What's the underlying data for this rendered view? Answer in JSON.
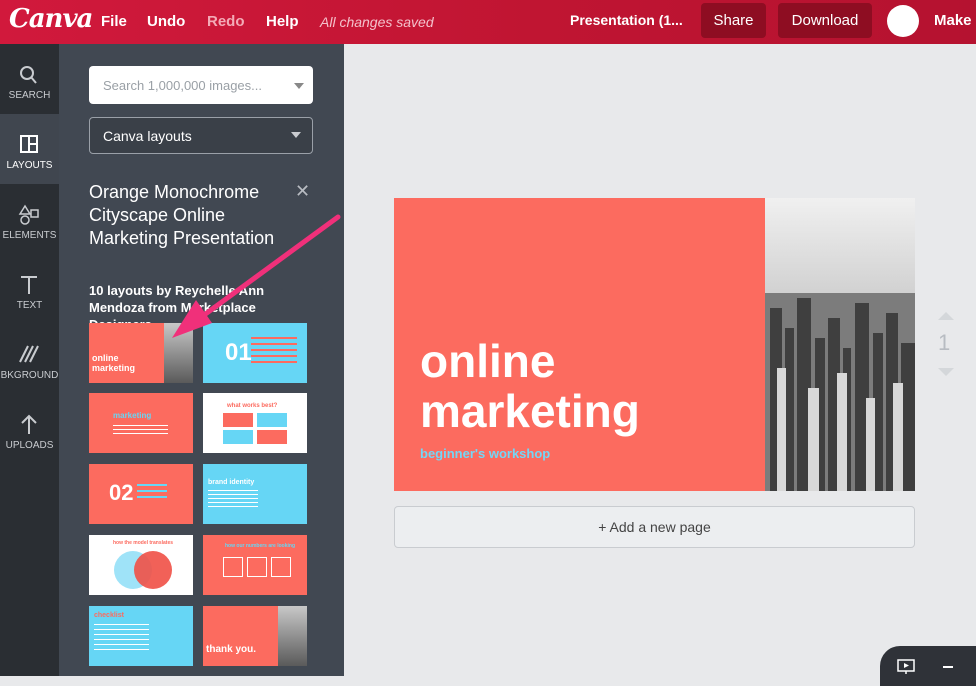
{
  "topbar": {
    "logo": "Canva",
    "menu": {
      "file": "File",
      "undo": "Undo",
      "redo": "Redo",
      "help": "Help"
    },
    "status": "All changes saved",
    "presentation_title": "Presentation (1...",
    "share_label": "Share",
    "download_label": "Download",
    "make_label": "Make"
  },
  "nav": [
    {
      "label": "SEARCH",
      "icon": "magnifier-icon"
    },
    {
      "label": "LAYOUTS",
      "icon": "layout-icon"
    },
    {
      "label": "ELEMENTS",
      "icon": "shapes-icon"
    },
    {
      "label": "TEXT",
      "icon": "text-icon"
    },
    {
      "label": "BKGROUND",
      "icon": "background-icon"
    },
    {
      "label": "UPLOADS",
      "icon": "upload-arrow-icon"
    }
  ],
  "panel": {
    "search_placeholder": "Search 1,000,000 images...",
    "dropdown_value": "Canva layouts",
    "template_title": "Orange Monochrome Cityscape Online Marketing Presentation",
    "template_sub": "10 layouts by Reychelle Ann Mendoza from Marketplace Designers",
    "thumbnails": [
      {
        "text": "online marketing",
        "bg": "#fc6b5f"
      },
      {
        "text": "01",
        "bg": "#66d6f5"
      },
      {
        "text": "marketing",
        "bg": "#fc6b5f"
      },
      {
        "text": "what works best?",
        "bg": "#ffffff"
      },
      {
        "text": "02",
        "bg": "#fc6b5f"
      },
      {
        "text": "brand identity",
        "bg": "#66d6f5"
      },
      {
        "text": "how the model translates",
        "bg": "#ffffff"
      },
      {
        "text": "how our numbers are looking",
        "bg": "#fc6b5f"
      },
      {
        "text": "checklist",
        "bg": "#66d6f5"
      },
      {
        "text": "thank you.",
        "bg": "#fc6b5f"
      }
    ]
  },
  "slide": {
    "line1": "online",
    "line2": "marketing",
    "subtitle": "beginner's workshop",
    "accent": "#fc6b5f",
    "sub_color": "#74d6f6"
  },
  "page_number": "1",
  "add_page_label": "+ Add a new page",
  "colors": {
    "topbar": "#c01532",
    "panel": "#414852",
    "nav": "#2a2e33"
  }
}
